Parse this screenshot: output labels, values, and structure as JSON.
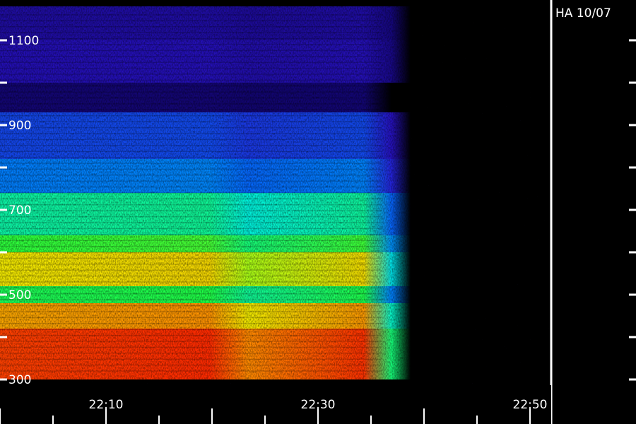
{
  "chart_data": {
    "type": "heatmap",
    "title": "",
    "xlabel": "",
    "ylabel": "",
    "badge": "HA 10/07",
    "x_ticks": [
      "22:10",
      "22:30",
      "22:50"
    ],
    "y_ticks": [
      "1100",
      "900",
      "700",
      "500",
      "300"
    ],
    "ylim": [
      300,
      1100
    ],
    "grid": false,
    "colors": {
      "background": "#000000",
      "axis": "#ffffff",
      "divider": "#ffffff",
      "colormap": [
        "#0a0050",
        "#2b14d0",
        "#0070ff",
        "#00f0e0",
        "#20ff40",
        "#f0ff00",
        "#ff8800",
        "#ff1a00"
      ]
    },
    "bands": [
      {
        "from": 300,
        "to": 420,
        "level": 0.95
      },
      {
        "from": 420,
        "to": 480,
        "level": 0.82
      },
      {
        "from": 480,
        "to": 520,
        "level": 0.55
      },
      {
        "from": 520,
        "to": 600,
        "level": 0.74
      },
      {
        "from": 600,
        "to": 640,
        "level": 0.58
      },
      {
        "from": 640,
        "to": 740,
        "level": 0.48
      },
      {
        "from": 740,
        "to": 820,
        "level": 0.3
      },
      {
        "from": 820,
        "to": 930,
        "level": 0.22
      },
      {
        "from": 930,
        "to": 1000,
        "level": 0.04
      },
      {
        "from": 1000,
        "to": 1100,
        "level": 0.11
      },
      {
        "from": 1100,
        "to": 1180,
        "level": 0.09
      }
    ]
  }
}
